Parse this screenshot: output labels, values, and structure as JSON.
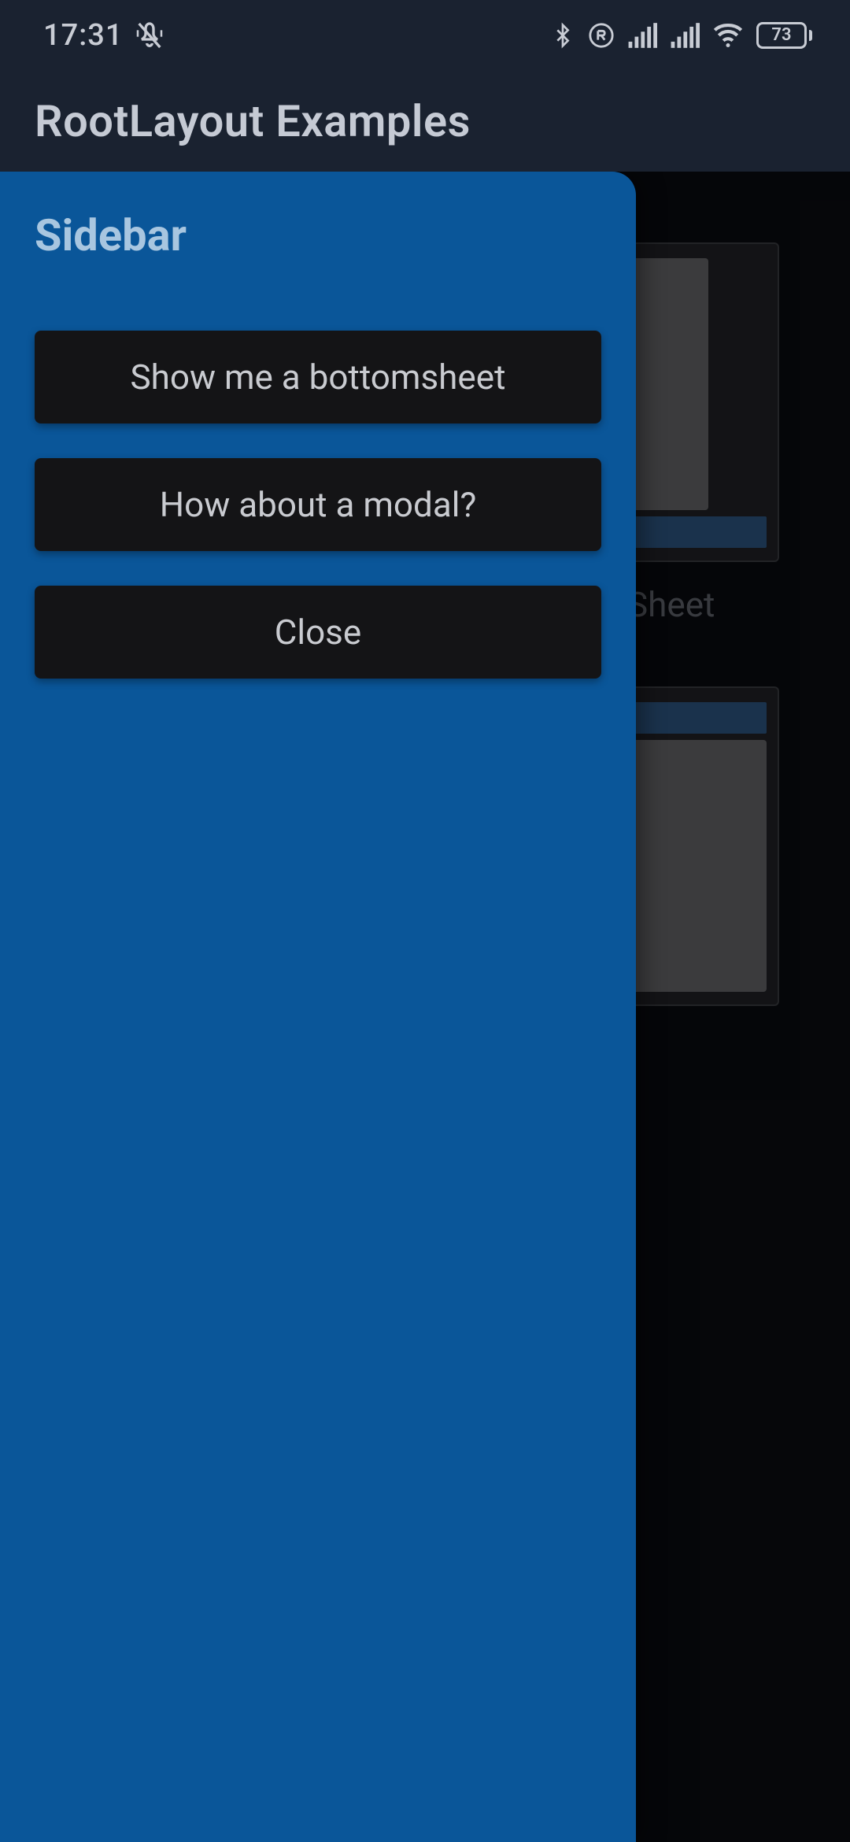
{
  "status": {
    "time": "17:31",
    "battery_percent": "73"
  },
  "appbar": {
    "title": "RootLayout Examples"
  },
  "sidebar": {
    "title": "Sidebar",
    "buttons": {
      "bottomsheet": "Show me a bottomsheet",
      "modal": "How about a modal?",
      "close": "Close"
    }
  },
  "background": {
    "card_label_1": "Sheet"
  }
}
